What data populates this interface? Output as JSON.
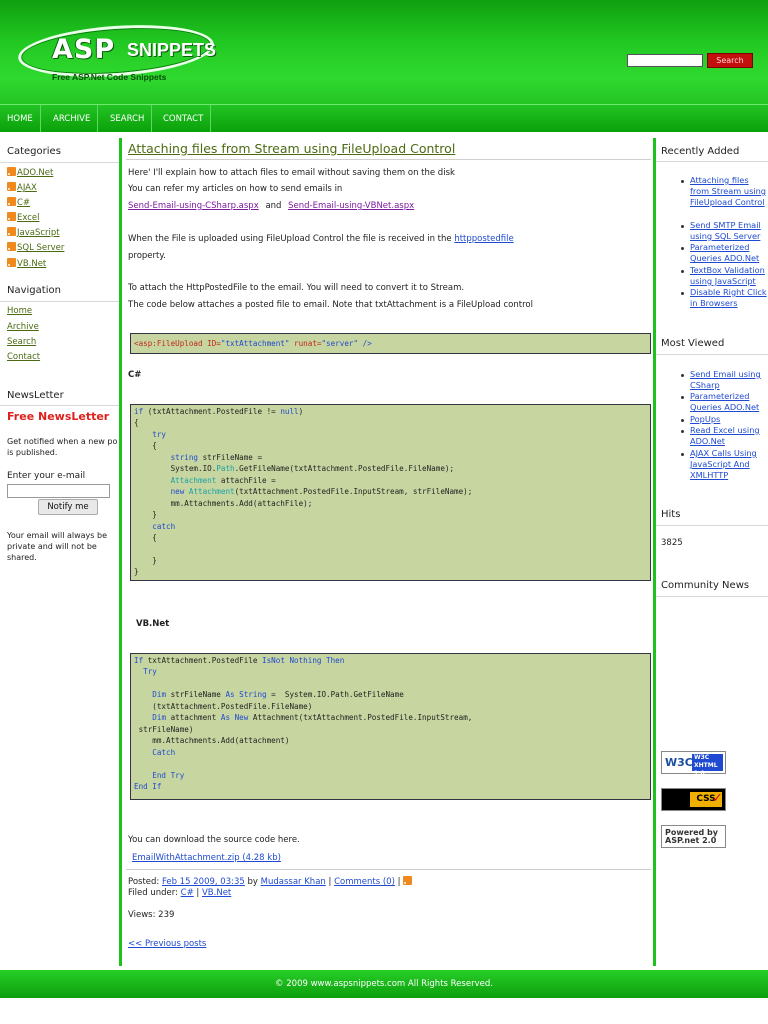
{
  "header": {
    "logo_asp": "ASP",
    "logo_snippets": "SNIPPETS",
    "logo_tagline": "Free ASP.Net Code Snippets",
    "search_button": "Search"
  },
  "nav": [
    "HOME",
    "ARCHIVE",
    "SEARCH",
    "CONTACT"
  ],
  "left": {
    "categories_heading": "Categories",
    "categories": [
      "ADO.Net",
      "AJAX",
      "C#",
      "Excel",
      "JavaScript",
      "SQL Server",
      "VB.Net"
    ],
    "navigation_heading": "Navigation",
    "navigation": [
      "Home",
      "Archive",
      "Search",
      "Contact"
    ],
    "newsletter_heading": "NewsLetter",
    "newsletter_title": "Free NewsLetter",
    "newsletter_text_1": "Get notified when a new po",
    "newsletter_text_2": "is published.",
    "email_label": "Enter your e-mail",
    "notify_button": "Notify me",
    "privacy_1": "Your email will always be",
    "privacy_2": "private and will not be",
    "privacy_3": "shared."
  },
  "post": {
    "title": "Attaching files from Stream using FileUpload Control",
    "intro_1": "Here' I'll explain how to attach files to email without saving them on the disk",
    "intro_2": "You can refer my articles on how to send emails in",
    "link_csharp": "Send-Email-using-CSharp.aspx",
    "and": "and",
    "link_vbnet": "Send-Email-using-VBNet.aspx",
    "para_received": "When the File is uploaded using FileUpload Control the file is received in the",
    "link_httppostedfile": "httppostedfile",
    "property": "property.",
    "attach_1": "To attach the HttpPostedFile  to the email. You will need to convert it to Stream.",
    "attach_2": "The code below attaches a posted file to email. Note that txtAttachment is  a FileUpload control",
    "markup_code": {
      "tag": "<asp:FileUpload",
      "attr_id": "ID=",
      "val_id": "\"txtAttachment\"",
      "attr_runat": "runat=",
      "val_runat": "\"server\"",
      "close": "/>"
    },
    "csharp_label": "C#",
    "csharp_code": [
      "if (txtAttachment.PostedFile != null)",
      "{",
      "    try",
      "    {",
      "        string strFileName =",
      "        System.IO.Path.GetFileName(txtAttachment.PostedFile.FileName);",
      "        Attachment attachFile =",
      "        new Attachment(txtAttachment.PostedFile.InputStream, strFileName);",
      "        mm.Attachments.Add(attachFile);",
      "    }",
      "    catch",
      "    {",
      "",
      "    }",
      "}"
    ],
    "vbnet_label": "VB.Net",
    "vb_code": [
      "If txtAttachment.PostedFile IsNot Nothing Then",
      "  Try",
      "",
      "    Dim strFileName As String =  System.IO.Path.GetFileName",
      "    (txtAttachment.PostedFile.FileName)",
      "    Dim attachment As New Attachment(txtAttachment.PostedFile.InputStream,",
      " strFileName)",
      "    mm.Attachments.Add(attachment)",
      "    Catch",
      "",
      "    End Try",
      "End If"
    ],
    "download_text": "You can download the source code here.",
    "download_link": "EmailWithAttachment.zip (4.28 kb)",
    "posted_label": "Posted:",
    "posted_date": "Feb 15 2009, 03:35",
    "by": "by",
    "author": "Mudassar Khan",
    "comments": "Comments (0)",
    "filed_label": "Filed under:",
    "filed_1": "C#",
    "filed_sep": "|",
    "filed_2": "VB.Net",
    "views": "Views: 239",
    "previous": "<< Previous posts"
  },
  "right": {
    "recent_heading": "Recently Added",
    "recent": [
      "Attaching files from Stream using FileUpload Control",
      "Send SMTP Email using SQL Server",
      "Parameterized Queries ADO.Net",
      "TextBox Validation using JavaScript",
      "Disable Right Click in Browsers"
    ],
    "most_heading": "Most Viewed",
    "most": [
      "Send Email using CSharp",
      "Parameterized Queries ADO.Net",
      "PopUps",
      "Read Excel using ADO.Net",
      "AJAX Calls Using JavaScript And XMLHTTP"
    ],
    "hits_heading": "Hits",
    "hits": "3825",
    "community_heading": "Community News",
    "badge_xhtml": "W3C XHTML 1.0",
    "badge_css": "CSS",
    "badge_aspnet": "Powered by ASP.net 2.0"
  },
  "footer": {
    "text": "© 2009 www.aspsnippets.com   All Rights Reserved."
  },
  "colors": {
    "brand_green": "#1ec11e",
    "search_red": "#c40f0f",
    "newsletter_red": "#e0201c",
    "link_olive": "#4b6a12",
    "link_blue": "#1f4ad1",
    "code_bg": "#c7d6a0"
  }
}
